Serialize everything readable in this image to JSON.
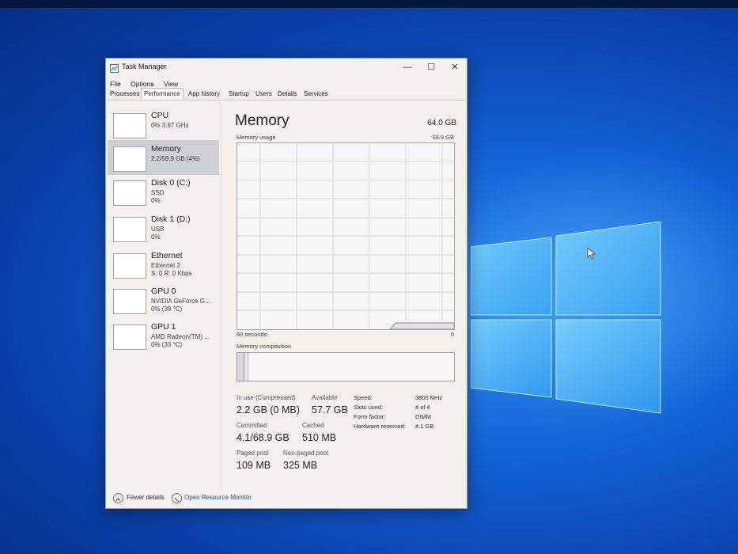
{
  "window": {
    "title": "Task Manager",
    "controls": {
      "minimize": "—",
      "maximize": "☐",
      "close": "✕"
    }
  },
  "menu": [
    "File",
    "Options",
    "View"
  ],
  "tabs": [
    "Processes",
    "Performance",
    "App history",
    "Startup",
    "Users",
    "Details",
    "Services"
  ],
  "active_tab": "Performance",
  "resources": [
    {
      "name": "CPU",
      "line1": "0% 3.87 GHz",
      "line2": ""
    },
    {
      "name": "Memory",
      "line1": "2.2/59.9 GB (4%)",
      "line2": ""
    },
    {
      "name": "Disk 0 (C:)",
      "line1": "SSD",
      "line2": "0%"
    },
    {
      "name": "Disk 1 (D:)",
      "line1": "USB",
      "line2": "0%"
    },
    {
      "name": "Ethernet",
      "line1": "Ethernet 2",
      "line2": "S: 0 R: 0 Kbps"
    },
    {
      "name": "GPU 0",
      "line1": "NVIDIA GeForce G...",
      "line2": "0% (39 °C)"
    },
    {
      "name": "GPU 1",
      "line1": "AMD Radeon(TM) ...",
      "line2": "0% (33 °C)"
    }
  ],
  "selected_resource": "Memory",
  "memory": {
    "title": "Memory",
    "total": "64.0 GB",
    "usage_label": "Memory usage",
    "usage_max": "59.9 GB",
    "time_left": "60 seconds",
    "time_right": "0",
    "composition_label": "Memory composition",
    "stats": {
      "in_use_label": "In use (Compressed)",
      "in_use_value": "2.2 GB (0 MB)",
      "available_label": "Available",
      "available_value": "57.7 GB",
      "committed_label": "Committed",
      "committed_value": "4.1/68.9 GB",
      "cached_label": "Cached",
      "cached_value": "510 MB",
      "paged_label": "Paged pool",
      "paged_value": "109 MB",
      "nonpaged_label": "Non-paged pool",
      "nonpaged_value": "325 MB"
    },
    "hardware": {
      "speed_label": "Speed:",
      "speed_value": "3800 MHz",
      "slots_label": "Slots used:",
      "slots_value": "4 of 4",
      "form_label": "Form factor:",
      "form_value": "DIMM",
      "reserved_label": "Hardware reserved:",
      "reserved_value": "4.1 GB"
    }
  },
  "footer": {
    "fewer_details": "Fewer details",
    "open_monitor": "Open Resource Monitor"
  }
}
